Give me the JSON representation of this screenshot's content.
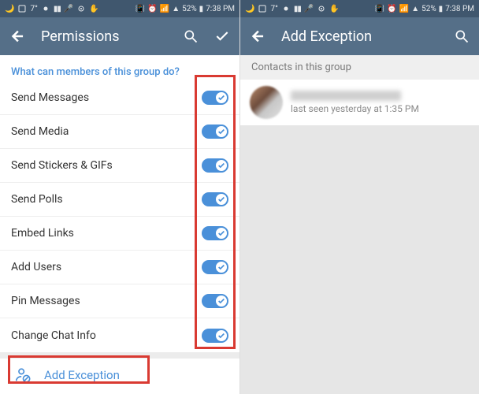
{
  "status": {
    "temp": "7°",
    "battery": "52%",
    "time": "7:38 PM"
  },
  "left": {
    "title": "Permissions",
    "section": "What can members of this group do?",
    "perms": [
      {
        "label": "Send Messages",
        "on": true
      },
      {
        "label": "Send Media",
        "on": true
      },
      {
        "label": "Send Stickers & GIFs",
        "on": true
      },
      {
        "label": "Send Polls",
        "on": true
      },
      {
        "label": "Embed Links",
        "on": true
      },
      {
        "label": "Add Users",
        "on": true
      },
      {
        "label": "Pin Messages",
        "on": true
      },
      {
        "label": "Change Chat Info",
        "on": true
      }
    ],
    "add_exception": "Add Exception"
  },
  "right": {
    "title": "Add Exception",
    "group_header": "Contacts in this group",
    "contact_status": "last seen yesterday at 1:35 PM"
  }
}
